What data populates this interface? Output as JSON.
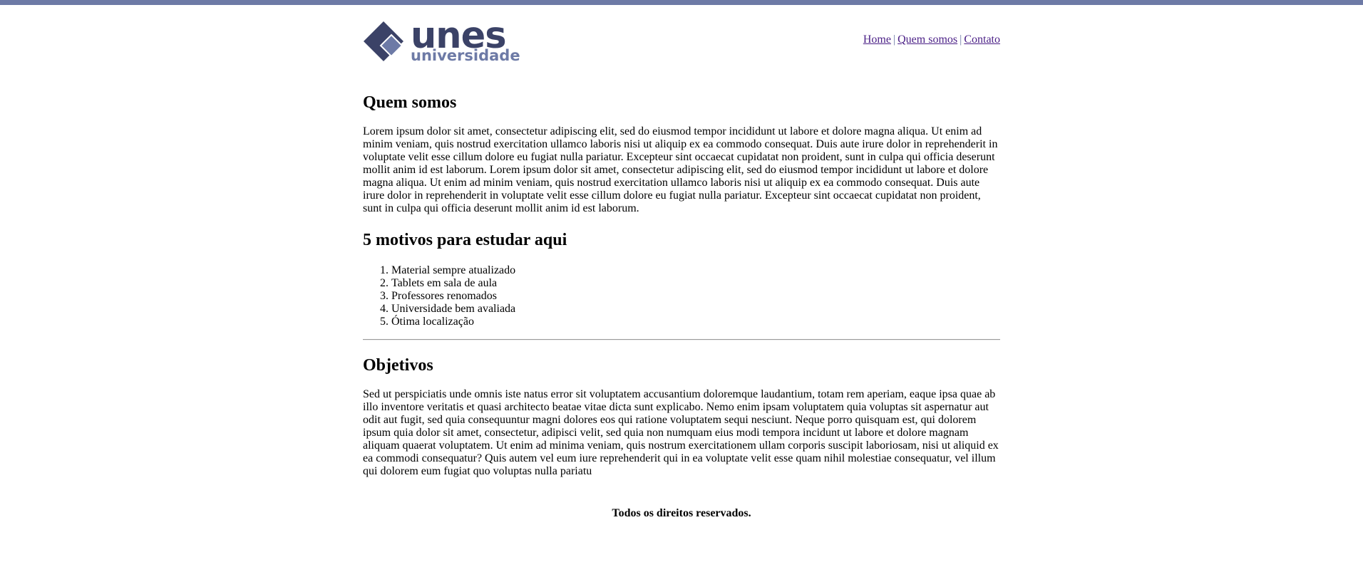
{
  "brand": {
    "logo_word": "unes",
    "logo_sub": "universidade",
    "colors": {
      "dark": "#3b4267",
      "light": "#6d7aa6"
    }
  },
  "nav": {
    "home": "Home",
    "about": "Quem somos",
    "contact": "Contato",
    "separator": "|"
  },
  "about": {
    "title": "Quem somos",
    "text": "Lorem ipsum dolor sit amet, consectetur adipiscing elit, sed do eiusmod tempor incididunt ut labore et dolore magna aliqua. Ut enim ad minim veniam, quis nostrud exercitation ullamco laboris nisi ut aliquip ex ea commodo consequat. Duis aute irure dolor in reprehenderit in voluptate velit esse cillum dolore eu fugiat nulla pariatur. Excepteur sint occaecat cupidatat non proident, sunt in culpa qui officia deserunt mollit anim id est laborum. Lorem ipsum dolor sit amet, consectetur adipiscing elit, sed do eiusmod tempor incididunt ut labore et dolore magna aliqua. Ut enim ad minim veniam, quis nostrud exercitation ullamco laboris nisi ut aliquip ex ea commodo consequat. Duis aute irure dolor in reprehenderit in voluptate velit esse cillum dolore eu fugiat nulla pariatur. Excepteur sint occaecat cupidatat non proident, sunt in culpa qui officia deserunt mollit anim id est laborum."
  },
  "reasons": {
    "title": "5 motivos para estudar aqui",
    "items": [
      "Material sempre atualizado",
      "Tablets em sala de aula",
      "Professores renomados",
      "Universidade bem avaliada",
      "Ótima localização"
    ]
  },
  "goals": {
    "title": "Objetivos",
    "text": "Sed ut perspiciatis unde omnis iste natus error sit voluptatem accusantium doloremque laudantium, totam rem aperiam, eaque ipsa quae ab illo inventore veritatis et quasi architecto beatae vitae dicta sunt explicabo. Nemo enim ipsam voluptatem quia voluptas sit aspernatur aut odit aut fugit, sed quia consequuntur magni dolores eos qui ratione voluptatem sequi nesciunt. Neque porro quisquam est, qui dolorem ipsum quia dolor sit amet, consectetur, adipisci velit, sed quia non numquam eius modi tempora incidunt ut labore et dolore magnam aliquam quaerat voluptatem. Ut enim ad minima veniam, quis nostrum exercitationem ullam corporis suscipit laboriosam, nisi ut aliquid ex ea commodi consequatur? Quis autem vel eum iure reprehenderit qui in ea voluptate velit esse quam nihil molestiae consequatur, vel illum qui dolorem eum fugiat quo voluptas nulla pariatu"
  },
  "footer": {
    "text": "Todos os direitos reservados."
  }
}
